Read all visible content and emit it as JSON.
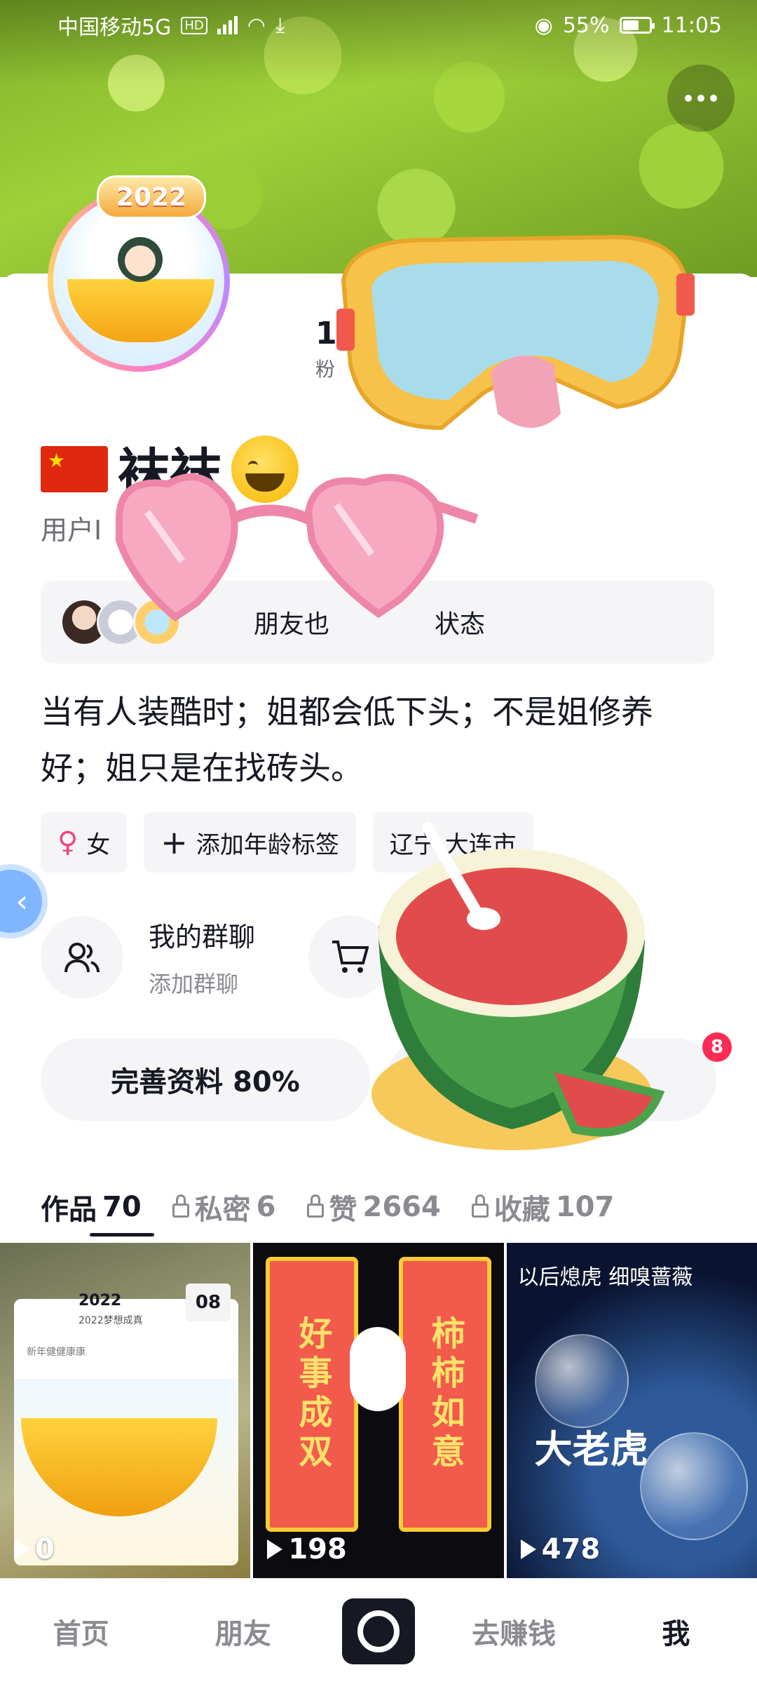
{
  "status_bar": {
    "carrier": "中国移动5G",
    "net_tag": "HD",
    "battery": "55%",
    "time": "11:05"
  },
  "header": {
    "more_icon": "more-dots-icon"
  },
  "profile": {
    "avatar_badge": "2022",
    "stats_value": "1",
    "stats_label": "粉",
    "nickname": "袜袜",
    "user_id_prefix": "用户I",
    "friends_text": "朋友也",
    "friends_text_tail": "状态",
    "bio": "当有人装酷时；姐都会低下头；不是姐修养好；姐只是在找砖头。",
    "tags": {
      "gender": "女",
      "age": "添加年龄标签",
      "location": "辽宁 大连市"
    },
    "group": {
      "title": "我的群聊",
      "subtitle": "添加群聊"
    },
    "complete_button": "完善资料 80%",
    "notification_count": "8"
  },
  "tabs": [
    {
      "label": "作品",
      "count": "70",
      "locked": false
    },
    {
      "label": "私密",
      "count": "6",
      "locked": true
    },
    {
      "label": "赞",
      "count": "2664",
      "locked": true
    },
    {
      "label": "收藏",
      "count": "107",
      "locked": true
    }
  ],
  "videos": [
    {
      "plays": "0",
      "card_year": "2022",
      "card_sub": "2022梦想成真",
      "card_date": "08",
      "card_note": "新年健健康康"
    },
    {
      "plays": "198",
      "scroll_left": "好事成双",
      "scroll_right": "柿柿如意"
    },
    {
      "plays": "478",
      "text_top": "以后熄虎 细嗅蔷薇",
      "text_big": "大老虎"
    }
  ],
  "bottom_nav": {
    "home": "首页",
    "friends": "朋友",
    "earn": "去赚钱",
    "me": "我"
  },
  "colors": {
    "accent_red": "#fe2c55",
    "text_primary": "#161823",
    "text_secondary": "#8a8b91",
    "chip_bg": "#f5f5f7"
  }
}
